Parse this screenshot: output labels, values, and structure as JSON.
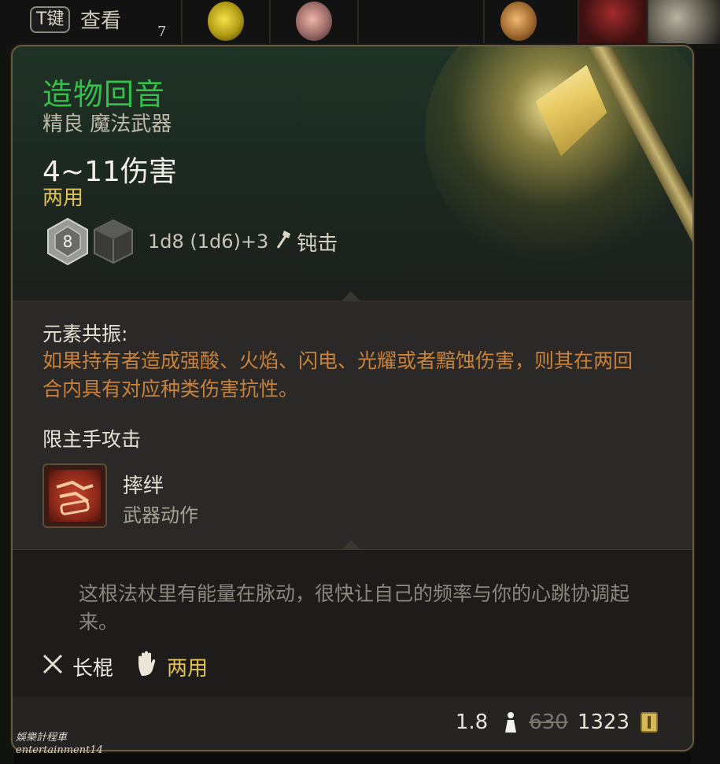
{
  "top_bar": {
    "key_hint": "T键",
    "view_label": "查看",
    "stack_count": "7"
  },
  "item": {
    "name": "造物回音",
    "rarity_type": "精良 魔法武器",
    "damage": "4~11伤害",
    "handedness": "两用",
    "dice_formula": "1d8 (1d6)+3",
    "damage_type": "钝击",
    "die_face": "8",
    "name_color": "#35c04a"
  },
  "properties": {
    "resonance_label": "元素共振:",
    "resonance_desc": "如果持有者造成强酸、火焰、闪电、光耀或者黯蚀伤害，则其在两回合内具有对应种类伤害抗性。",
    "mainhand_label": "限主手攻击",
    "action_name": "摔绊",
    "action_type": "武器动作"
  },
  "flavor": {
    "text": "这根法杖里有能量在脉动，很快让自己的频率与你的心跳协调起来。",
    "weapon_class": "长棍",
    "hand_type": "两用"
  },
  "footer": {
    "weight": "1.8",
    "old_price": "630",
    "price": "1323"
  },
  "watermark": {
    "line1": "娛樂計程車",
    "line2": "entertainment14"
  },
  "icons": [
    "t-key-icon",
    "d8-die-icon",
    "d6-die-icon",
    "mace-icon",
    "trip-action-icon",
    "crossed-swords-icon",
    "hand-icon",
    "weight-icon",
    "gold-coin-icon"
  ]
}
